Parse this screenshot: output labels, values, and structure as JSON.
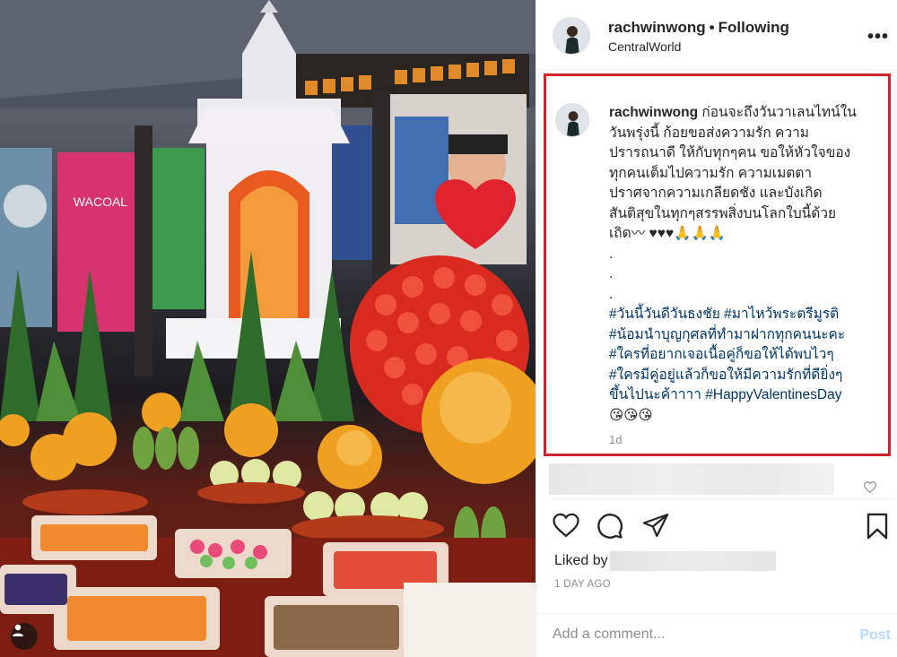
{
  "header": {
    "username": "rachwinwong",
    "separator": "•",
    "follow_status": "Following",
    "location": "CentralWorld",
    "more_label": "•••"
  },
  "caption": {
    "username": "rachwinwong",
    "lines": [
      "ก่อนจะถึงวันวาเลนไทน์ใน",
      "วันพรุ่งนี้ ก้อยขอส่งความรัก ความ",
      "ปรารถนาดี ให้กับทุกๆคน ขอให้หัวใจของ",
      "ทุกคนเต็มไปความรัก ความเมตตา",
      "ปราศจากความเกลียดชัง และบังเกิด",
      "สันติสุขในทุกๆสรรพสิ่งบนโลกใบนี้ด้วย",
      "เถิด〰 ♥♥♥🙏🙏🙏",
      ".",
      ".",
      "."
    ],
    "hashtag_lines": [
      "#วันนี้วันดีวันธงชัย #มาไหว้พระตรีมูรติ",
      "#น้อมนำบุญกุศลที่ทำมาฝากทุกคนนะคะ",
      "#ใครที่อยากเจอเนื้อคู่ก็ขอให้ได้พบไวๆ",
      "#ใครมีคู่อยู่แล้วก็ขอให้มีความรักที่ดียิ่งๆ"
    ],
    "last_line_text": "ขึ้นไปนะค้าาาา ",
    "last_line_tag": "#HappyValentinesDay",
    "emoji_line": "😘😘😘",
    "time": "1d"
  },
  "actions": {
    "like_icon": "heart-outline-icon",
    "comment_icon": "comment-bubble-icon",
    "share_icon": "paper-plane-icon",
    "save_icon": "bookmark-icon"
  },
  "likes": {
    "label": "Liked by"
  },
  "timestamp": "1 DAY AGO",
  "add_comment": {
    "placeholder": "Add a comment...",
    "post_label": "Post"
  },
  "colors": {
    "highlight_border": "#d0232a",
    "hashtag": "#003569",
    "post_disabled": "#b3dbff"
  }
}
